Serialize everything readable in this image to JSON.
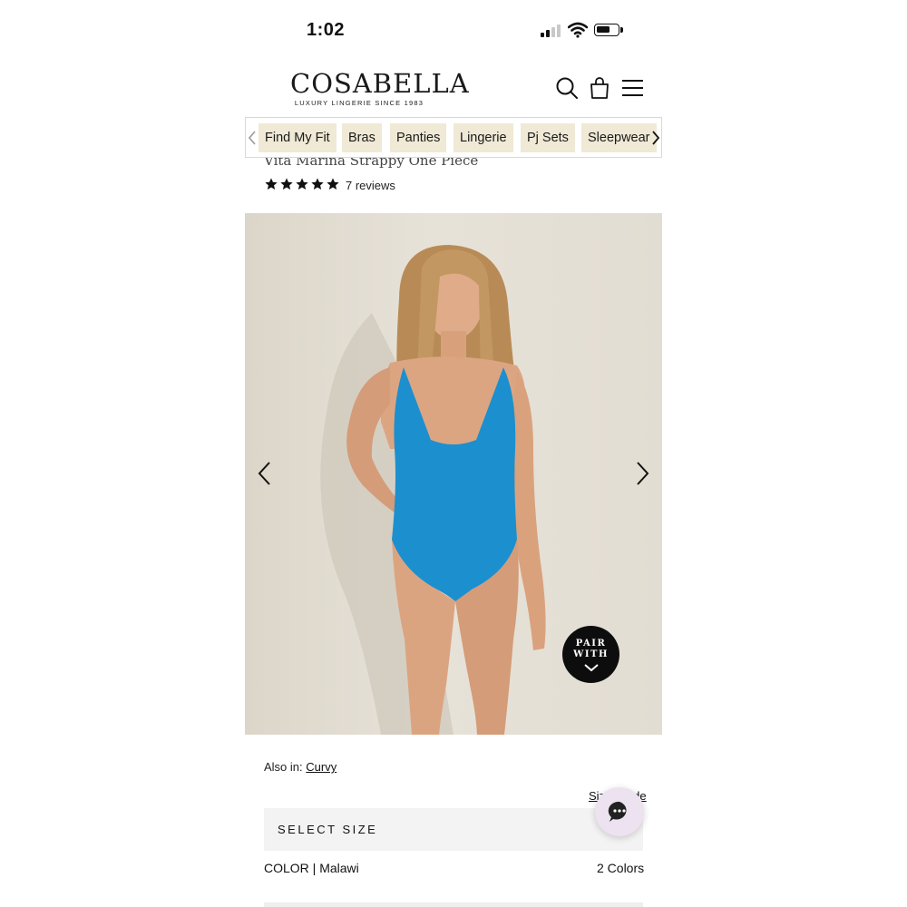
{
  "status_bar": {
    "time": "1:02"
  },
  "header": {
    "brand": "COSABELLA",
    "tagline": "LUXURY LINGERIE SINCE 1983",
    "icons": [
      "search-icon",
      "shopping-bag-icon",
      "menu-icon"
    ]
  },
  "category_nav": {
    "items": [
      "Find My Fit",
      "Bras",
      "Panties",
      "Lingerie",
      "Pj Sets",
      "Sleepwear"
    ],
    "pill_color": "#efe9d6"
  },
  "product": {
    "title": "Vita Marina Strappy One Piece",
    "rating": 5,
    "rating_max": 5,
    "reviews_label": "7 reviews"
  },
  "gallery": {
    "pair_with_line1": "PAIR",
    "pair_with_line2": "WITH",
    "swimsuit_color": "#1c8fcf"
  },
  "details": {
    "also_in_label": "Also in:",
    "also_in_link": "Curvy",
    "size_guide": "Size Guide",
    "select_size": "SELECT SIZE",
    "color_label": "COLOR | Malawi",
    "color_count": "2 Colors"
  }
}
